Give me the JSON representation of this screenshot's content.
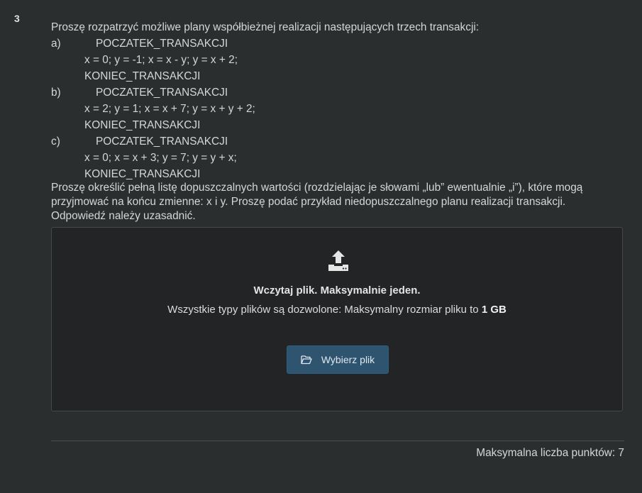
{
  "question": {
    "number": "3",
    "intro": "Proszę rozpatrzyć możliwe plany współbieżnej realizacji następujących trzech transakcji:",
    "transactions": [
      {
        "letter": "a)",
        "start": "POCZATEK_TRANSAKCJI",
        "body": "x = 0; y = -1; x = x - y; y = x + 2;",
        "end": "KONIEC_TRANSAKCJI"
      },
      {
        "letter": "b)",
        "start": "POCZATEK_TRANSAKCJI",
        "body": "x = 2; y = 1; x = x + 7; y = x + y + 2;",
        "end": "KONIEC_TRANSAKCJI"
      },
      {
        "letter": "c)",
        "start": "POCZATEK_TRANSAKCJI",
        "body": "x = 0; x = x + 3; y = 7; y = y + x;",
        "end": "KONIEC_TRANSAKCJI"
      }
    ],
    "task_lines": [
      "Proszę określić pełną listę dopuszczalnych wartości (rozdzielając je słowami „lub” ewentualnie „i”), które mogą",
      "przyjmować na końcu zmienne: x i y. Proszę podać przykład niedopuszczalnego planu realizacji transakcji.",
      "Odpowiedź należy uzasadnić."
    ]
  },
  "upload": {
    "icon": "upload-icon",
    "title": "Wczytaj plik. Maksymalnie jeden.",
    "subtitle_prefix": "Wszystkie typy plików są dozwolone: Maksymalny rozmiar pliku to ",
    "max_size": "1 GB",
    "button_icon": "folder-open-icon",
    "button_label": "Wybierz plik"
  },
  "footer": {
    "max_points": "Maksymalna liczba punktów: 7"
  },
  "colors": {
    "background": "#2b2e2f",
    "dropzone": "#222425",
    "button": "#2f5470"
  }
}
